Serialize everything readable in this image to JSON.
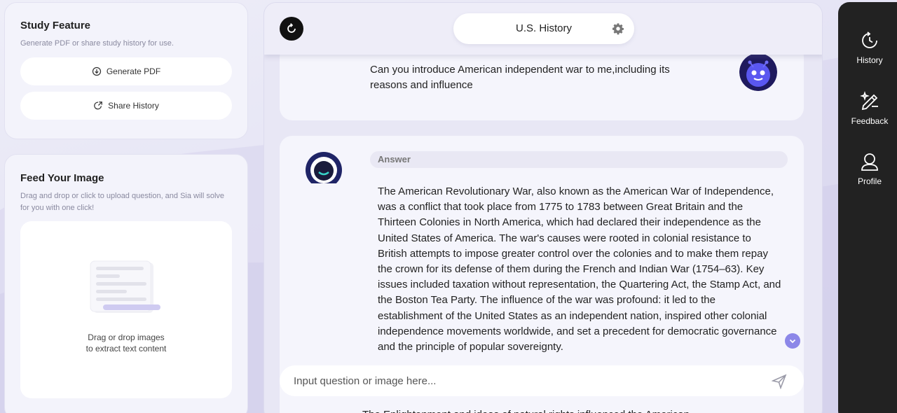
{
  "study": {
    "title": "Study Feature",
    "subtitle": "Generate PDF or share study history for use.",
    "generate_pdf_label": "Generate PDF",
    "share_history_label": "Share History"
  },
  "feed": {
    "title": "Feed Your Image",
    "subtitle": "Drag and drop or click to upload question, and Sia will solve for you with one click!",
    "drop_line1": "Drag or drop images",
    "drop_line2": "to extract text content"
  },
  "chat": {
    "topic": "U.S. History",
    "question": "Can you introduce American independent war to me,including its reasons and influence",
    "answer_label": "Answer",
    "answer_text": "The American Revolutionary War, also known as the American War of Independence, was a conflict that took place from 1775 to 1783 between Great Britain and the Thirteen Colonies in North America, which had declared their independence as the United States of America. The war's causes were rooted in colonial resistance to British attempts to impose greater control over the colonies and to make them repay the crown for its defense of them during the French and Indian War (1754–63). Key issues included taxation without representation, the Quartering Act, the Stamp Act, and the Boston Tea Party. The influence of the war was profound: it led to the establishment of the United States as an independent nation, inspired other colonial independence movements worldwide, and set a precedent for democratic governance and the principle of popular sovereignty.",
    "next_text_peek": "The Enlightenment and ideas of natural rights influenced the American",
    "input_placeholder": "Input question or image here..."
  },
  "sidebar": {
    "items": [
      {
        "label": "History",
        "icon": "history-icon"
      },
      {
        "label": "Feedback",
        "icon": "feedback-icon"
      },
      {
        "label": "Profile",
        "icon": "profile-icon"
      }
    ]
  },
  "colors": {
    "accent": "#8c87e8",
    "sidebar_bg": "#222222",
    "panel_bg": "#f3f3fb"
  }
}
